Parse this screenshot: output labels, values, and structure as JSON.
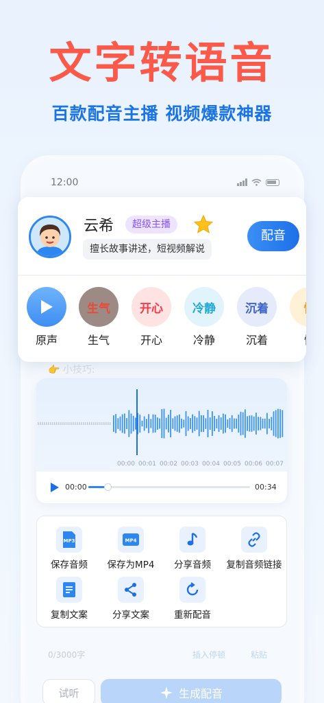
{
  "hero": {
    "title": "文字转语音",
    "subtitle": "百款配音主播 视频爆款神器"
  },
  "status_bar": {
    "time": "12:00"
  },
  "voice": {
    "name": "云希",
    "badge": "超级主播",
    "description": "擅长故事讲述，短视频解说",
    "dub_button": "配音"
  },
  "emotions": [
    {
      "label": "原声",
      "icon": "play-icon",
      "text": ""
    },
    {
      "label": "生气",
      "icon": "angry-tag",
      "text": "生气"
    },
    {
      "label": "开心",
      "icon": "happy-tag",
      "text": "开心"
    },
    {
      "label": "冷静",
      "icon": "calm-tag",
      "text": "冷静"
    },
    {
      "label": "沉着",
      "icon": "composed-tag",
      "text": "沉着"
    },
    {
      "label": "愉",
      "icon": "joy-tag",
      "text": "愉"
    }
  ],
  "tip": "👉 小技巧:",
  "player": {
    "timeline": [
      "00:00",
      "00:01",
      "00:02",
      "00:03",
      "00:04",
      "00:05",
      "00:06",
      "00:07"
    ],
    "current_time": "00:00",
    "total_time": "00:34",
    "progress": 0.12
  },
  "actions": [
    {
      "label": "保存音频",
      "icon": "mp3-file-icon",
      "icon_text": "MP3"
    },
    {
      "label": "保存为MP4",
      "icon": "mp4-file-icon",
      "icon_text": "MP4"
    },
    {
      "label": "分享音频",
      "icon": "music-note-icon",
      "icon_text": ""
    },
    {
      "label": "复制音频链接",
      "icon": "link-icon",
      "icon_text": ""
    },
    {
      "label": "复制文案",
      "icon": "document-icon",
      "icon_text": ""
    },
    {
      "label": "分享文案",
      "icon": "share-icon",
      "icon_text": ""
    },
    {
      "label": "重新配音",
      "icon": "refresh-icon",
      "icon_text": ""
    }
  ],
  "input": {
    "count": "0/3000字",
    "insert_pause": "插入停顿",
    "paste": "粘贴"
  },
  "bottom": {
    "trial": "试听",
    "generate": "生成配音"
  },
  "colors": {
    "title_red": "#fb5a4a",
    "accent_blue": "#1d6fe6",
    "badge_purple": "#8455f3"
  }
}
